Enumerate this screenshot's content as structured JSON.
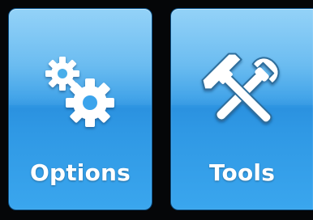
{
  "tiles": [
    {
      "label": "Options",
      "icon": "gears-icon"
    },
    {
      "label": "Tools",
      "icon": "hammer-wrench-icon"
    }
  ],
  "colors": {
    "background": "#050608",
    "tile_top": "#7cc8f6",
    "tile_bottom": "#3aa6ee",
    "text": "#ffffff"
  }
}
